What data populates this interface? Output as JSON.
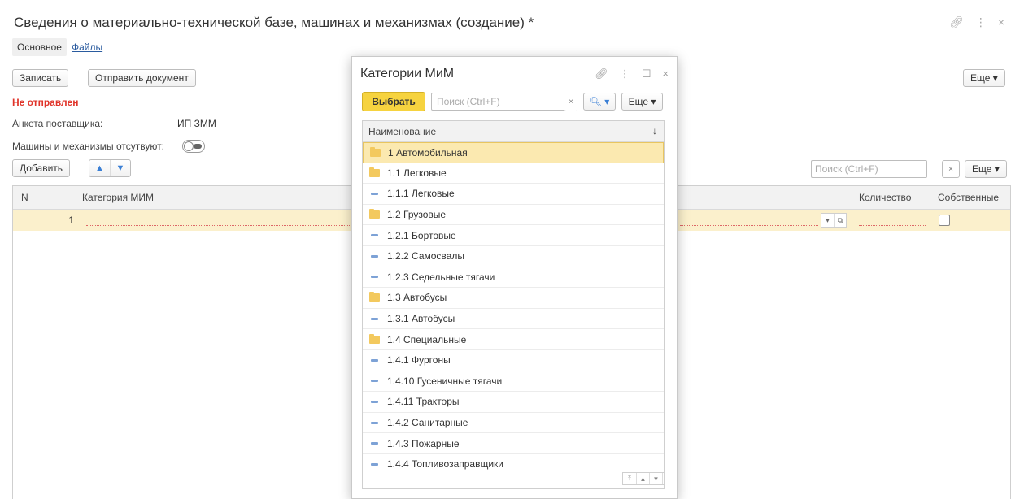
{
  "window": {
    "title": "Сведения о материально-технической базе, машинах и механизмах (создание) *",
    "tools": [
      "link-icon",
      "more-icon",
      "close-icon"
    ]
  },
  "tabs": [
    {
      "label": "Основное",
      "active": true
    },
    {
      "label": "Файлы",
      "active": false
    }
  ],
  "toolbar": {
    "save_label": "Записать",
    "send_label": "Отправить документ",
    "more_label": "Еще ▾"
  },
  "status": "Не отправлен",
  "fields": {
    "supplier_label": "Анкета поставщика:",
    "supplier_value": "ИП ЗММ",
    "machines_absent_label": "Машины и механизмы отсутвуют:",
    "machines_absent": false
  },
  "table_toolbar": {
    "add_label": "Добавить",
    "search_placeholder": "Поиск (Ctrl+F)",
    "clear_label": "×",
    "more_label": "Еще ▾"
  },
  "table": {
    "columns": [
      "N",
      "Категория МИМ",
      "Количество",
      "Собственные"
    ],
    "rows": [
      {
        "n": "1",
        "category": "",
        "quantity": "",
        "own": false
      }
    ]
  },
  "dialog": {
    "title": "Категории МиМ",
    "select_label": "Выбрать",
    "search_placeholder": "Поиск (Ctrl+F)",
    "clear_label": "×",
    "find_label": "🔍︎ ▾",
    "more_label": "Еще ▾",
    "column": "Наименование",
    "sort_glyph": "↓",
    "items": [
      {
        "label": "1 Автомобильная",
        "type": "folder",
        "selected": true
      },
      {
        "label": "1.1 Легковые",
        "type": "folder"
      },
      {
        "label": "1.1.1 Легковые",
        "type": "item"
      },
      {
        "label": "1.2 Грузовые",
        "type": "folder"
      },
      {
        "label": "1.2.1 Бортовые",
        "type": "item"
      },
      {
        "label": "1.2.2 Самосвалы",
        "type": "item"
      },
      {
        "label": "1.2.3 Седельные тягачи",
        "type": "item"
      },
      {
        "label": "1.3 Автобусы",
        "type": "folder"
      },
      {
        "label": "1.3.1 Автобусы",
        "type": "item"
      },
      {
        "label": "1.4 Специальные",
        "type": "folder"
      },
      {
        "label": "1.4.1 Фургоны",
        "type": "item"
      },
      {
        "label": "1.4.10 Гусеничные тягачи",
        "type": "item"
      },
      {
        "label": "1.4.11 Тракторы",
        "type": "item"
      },
      {
        "label": "1.4.2 Санитарные",
        "type": "item"
      },
      {
        "label": "1.4.3 Пожарные",
        "type": "item"
      },
      {
        "label": "1.4.4 Топливозаправщики",
        "type": "item"
      }
    ]
  }
}
